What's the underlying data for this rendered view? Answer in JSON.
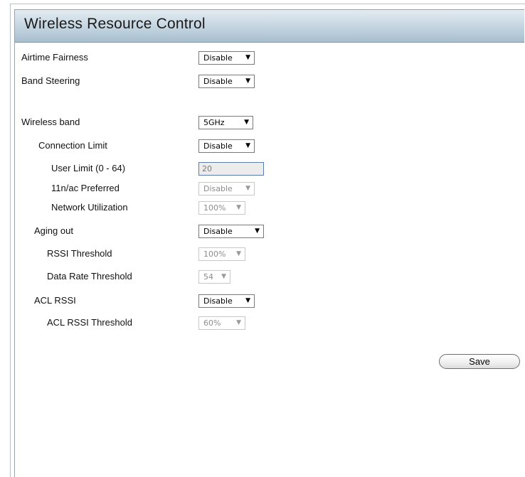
{
  "title": "Wireless Resource Control",
  "rows": {
    "airtime_fairness": {
      "label": "Airtime Fairness",
      "value": "Disable"
    },
    "band_steering": {
      "label": "Band Steering",
      "value": "Disable"
    },
    "wireless_band": {
      "label": "Wireless band",
      "value": "5GHz"
    },
    "connection_limit": {
      "label": "Connection Limit",
      "value": "Disable"
    },
    "user_limit": {
      "label": "User Limit (0 - 64)",
      "value": "20"
    },
    "preferred_11nac": {
      "label": "11n/ac Preferred",
      "value": "Disable"
    },
    "network_utilization": {
      "label": "Network Utilization",
      "value": "100%"
    },
    "aging_out": {
      "label": "Aging out",
      "value": "Disable"
    },
    "rssi_threshold": {
      "label": "RSSI Threshold",
      "value": "100%"
    },
    "data_rate_threshold": {
      "label": "Data Rate Threshold",
      "value": "54"
    },
    "acl_rssi": {
      "label": "ACL RSSI",
      "value": "Disable"
    },
    "acl_rssi_threshold": {
      "label": "ACL RSSI Threshold",
      "value": "60%"
    }
  },
  "save_label": "Save",
  "dropdown_arrow": "▼"
}
